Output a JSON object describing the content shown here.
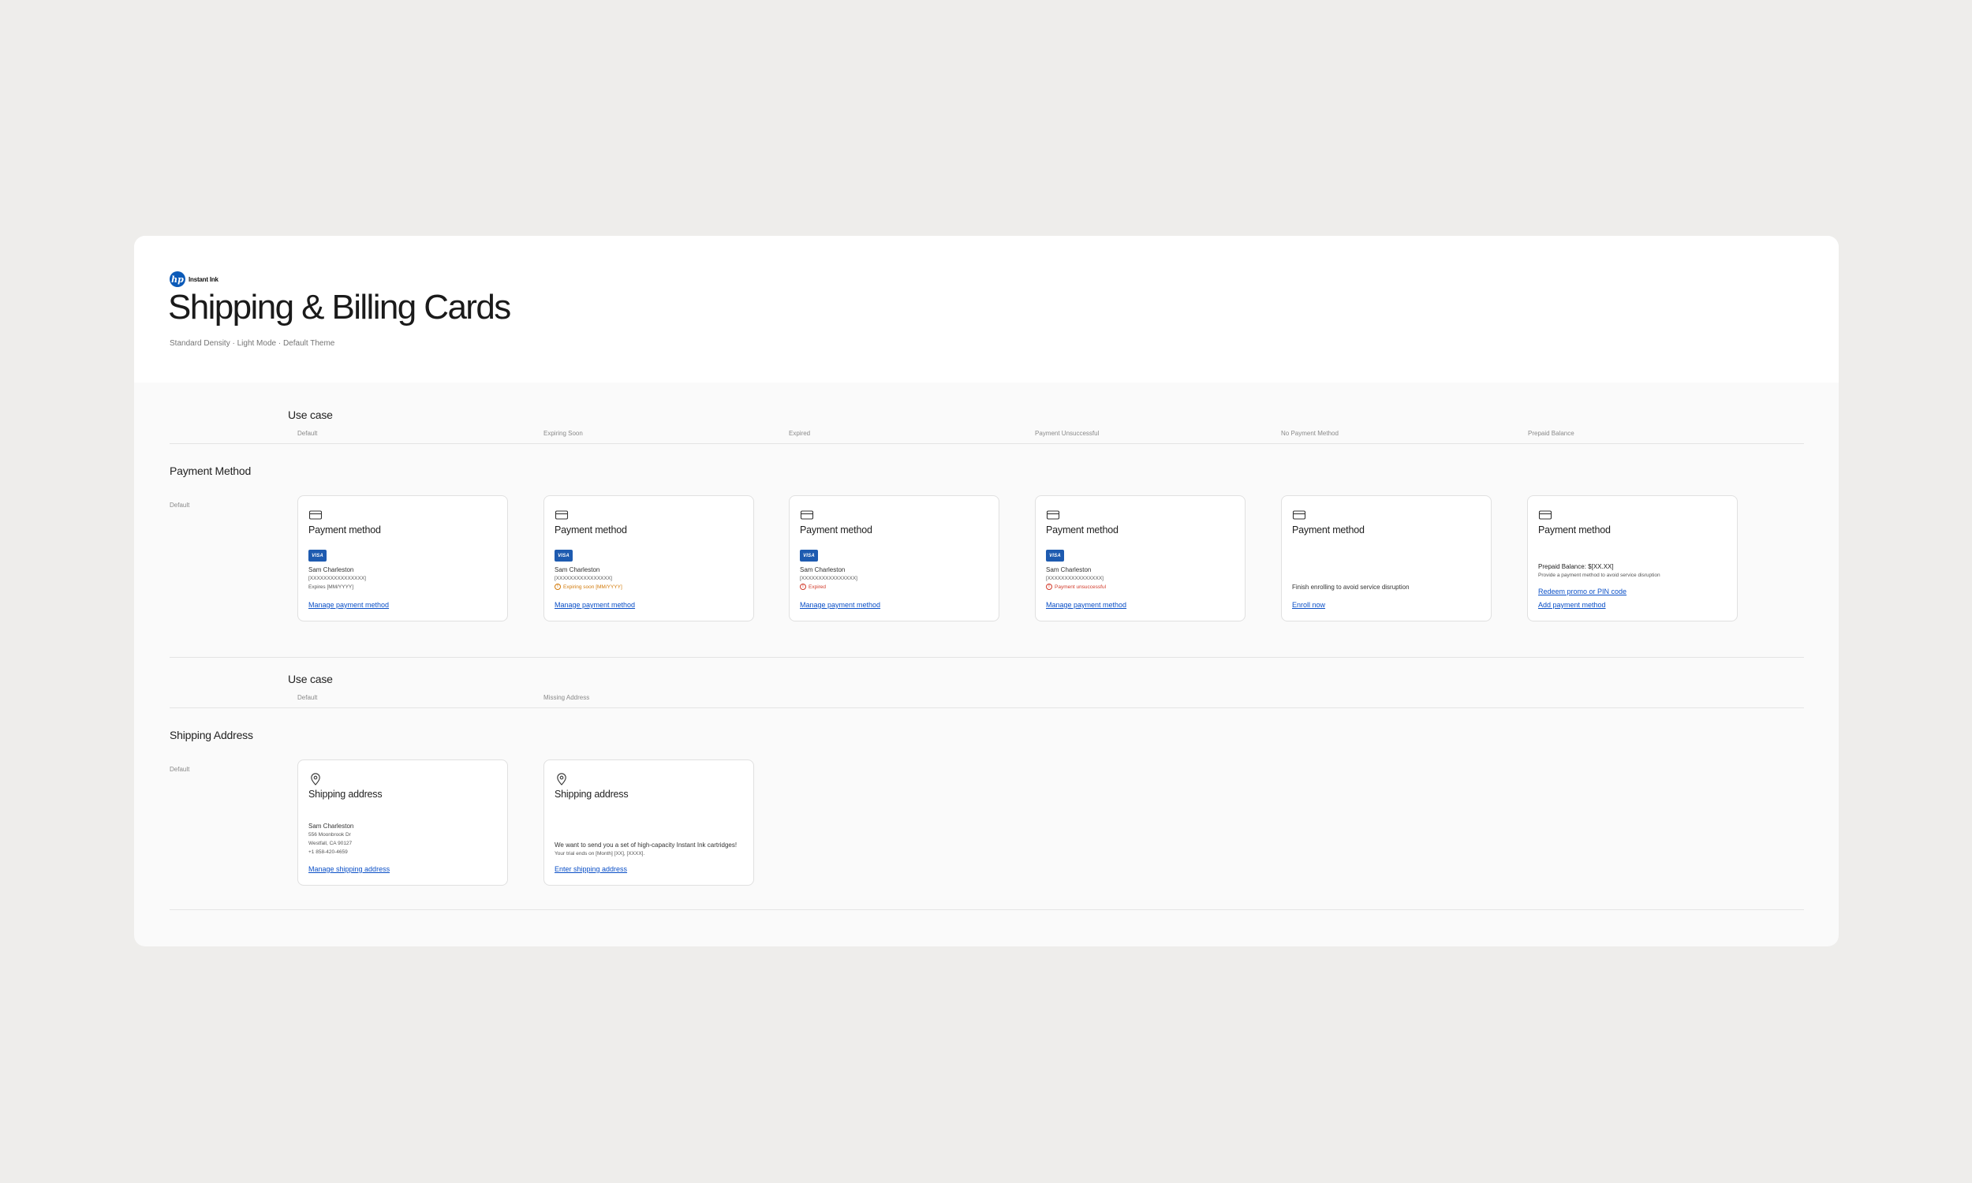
{
  "header": {
    "logo_mark": "hp",
    "logo_text": "Instant Ink",
    "title": "Shipping & Billing Cards",
    "subtitle": "Standard Density · Light Mode · Default Theme"
  },
  "payment_section": {
    "use_case_label": "Use case",
    "columns": [
      "Default",
      "Expiring Soon",
      "Expired",
      "Payment Unsuccessful",
      "No Payment Method",
      "Prepaid Balance"
    ],
    "section_title": "Payment Method",
    "row_label": "Default",
    "cards": [
      {
        "icon": "credit-card-icon",
        "title": "Payment method",
        "brand": "VISA",
        "name": "Sam Charleston",
        "number": "[XXXXXXXXXXXXXXXX]",
        "detail": "Expires [MM/YYYY]",
        "link": "Manage payment method"
      },
      {
        "icon": "credit-card-icon",
        "title": "Payment method",
        "brand": "VISA",
        "name": "Sam Charleston",
        "number": "[XXXXXXXXXXXXXXXX]",
        "status": "Expiring soon [MM/YYYY]",
        "link": "Manage payment method"
      },
      {
        "icon": "credit-card-icon",
        "title": "Payment method",
        "brand": "VISA",
        "name": "Sam Charleston",
        "number": "[XXXXXXXXXXXXXXXX]",
        "status": "Expired",
        "link": "Manage payment method"
      },
      {
        "icon": "credit-card-icon",
        "title": "Payment method",
        "brand": "VISA",
        "name": "Sam Charleston",
        "number": "[XXXXXXXXXXXXXXXX]",
        "status": "Payment unsuccessful",
        "link": "Manage payment method"
      },
      {
        "icon": "credit-card-icon",
        "title": "Payment method",
        "message": "Finish enrolling to avoid service disruption",
        "link": "Enroll now"
      },
      {
        "icon": "credit-card-icon",
        "title": "Payment method",
        "balance": "Prepaid Balance: $[XX.XX]",
        "note": "Provide a payment method to avoid service disruption",
        "link_1": "Redeem promo or PIN code",
        "link_2": "Add payment method"
      }
    ]
  },
  "shipping_section": {
    "use_case_label": "Use case",
    "columns": [
      "Default",
      "Missing Address"
    ],
    "section_title": "Shipping Address",
    "row_label": "Default",
    "cards": [
      {
        "icon": "location-pin-icon",
        "title": "Shipping address",
        "name": "Sam Charleston",
        "line1": "556 Moonbrook Dr",
        "line2": "Westfall, CA 90127",
        "phone": "+1 858-420-4659",
        "link": "Manage shipping address"
      },
      {
        "icon": "location-pin-icon",
        "title": "Shipping address",
        "message": "We want to send you a set of high-capacity Instant Ink cartridges!",
        "note": "Your trial ends on [Month] [XX], [XXXX].",
        "link": "Enter shipping address"
      }
    ]
  },
  "colors": {
    "link": "#0a4fc7",
    "visa": "#1e5bb0",
    "warning": "#d27a0a",
    "error": "#d23a2a"
  }
}
